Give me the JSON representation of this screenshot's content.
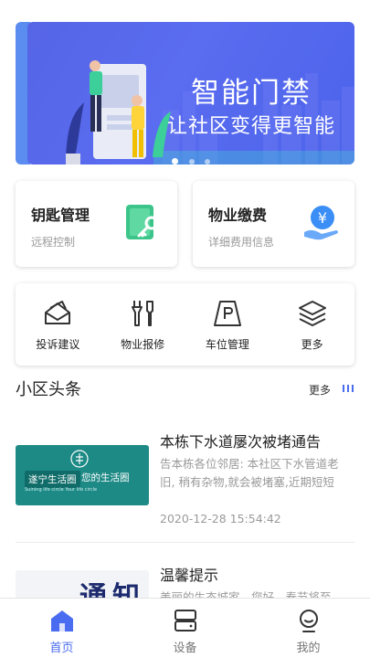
{
  "banner": {
    "title": "智能门禁",
    "subtitle": "让社区变得更智能",
    "slide_count": 3,
    "active_slide": 1
  },
  "cards": {
    "key": {
      "title": "钥匙管理",
      "subtitle": "远程控制",
      "icon": "key-icon",
      "color": "#3cc58a"
    },
    "fee": {
      "title": "物业缴费",
      "subtitle": "详细费用信息",
      "icon": "yen-hand-icon",
      "color": "#3a8ef5"
    }
  },
  "menu": [
    {
      "label": "投诉建议",
      "icon": "complaint-envelope-icon"
    },
    {
      "label": "物业报修",
      "icon": "repair-tools-icon"
    },
    {
      "label": "车位管理",
      "icon": "parking-icon"
    },
    {
      "label": "更多",
      "icon": "layers-icon"
    }
  ],
  "news": {
    "title": "小区头条",
    "more_label": "更多",
    "items": [
      {
        "headline": "本栋下水道屡次被堵通告",
        "summary": "告本栋各位邻居: 本社区下水管道老旧, 稍有杂物,就会被堵塞,近期短短",
        "time": "2020-12-28 15:54:42",
        "thumb_brand": "遂宁生活圈",
        "thumb_slogan": "您的生活圈",
        "thumb_english": "Suining life circle  Your life circle"
      },
      {
        "headline": "温馨提示",
        "summary": "美丽的生态城家，您好。春节将至",
        "thumb_text": "通知"
      }
    ]
  },
  "tabbar": [
    {
      "label": "首页",
      "icon": "home-icon",
      "active": true
    },
    {
      "label": "设备",
      "icon": "device-icon",
      "active": false
    },
    {
      "label": "我的",
      "icon": "profile-icon",
      "active": false
    }
  ],
  "colors": {
    "accent": "#4a6cf0",
    "banner": "#5565e6"
  }
}
